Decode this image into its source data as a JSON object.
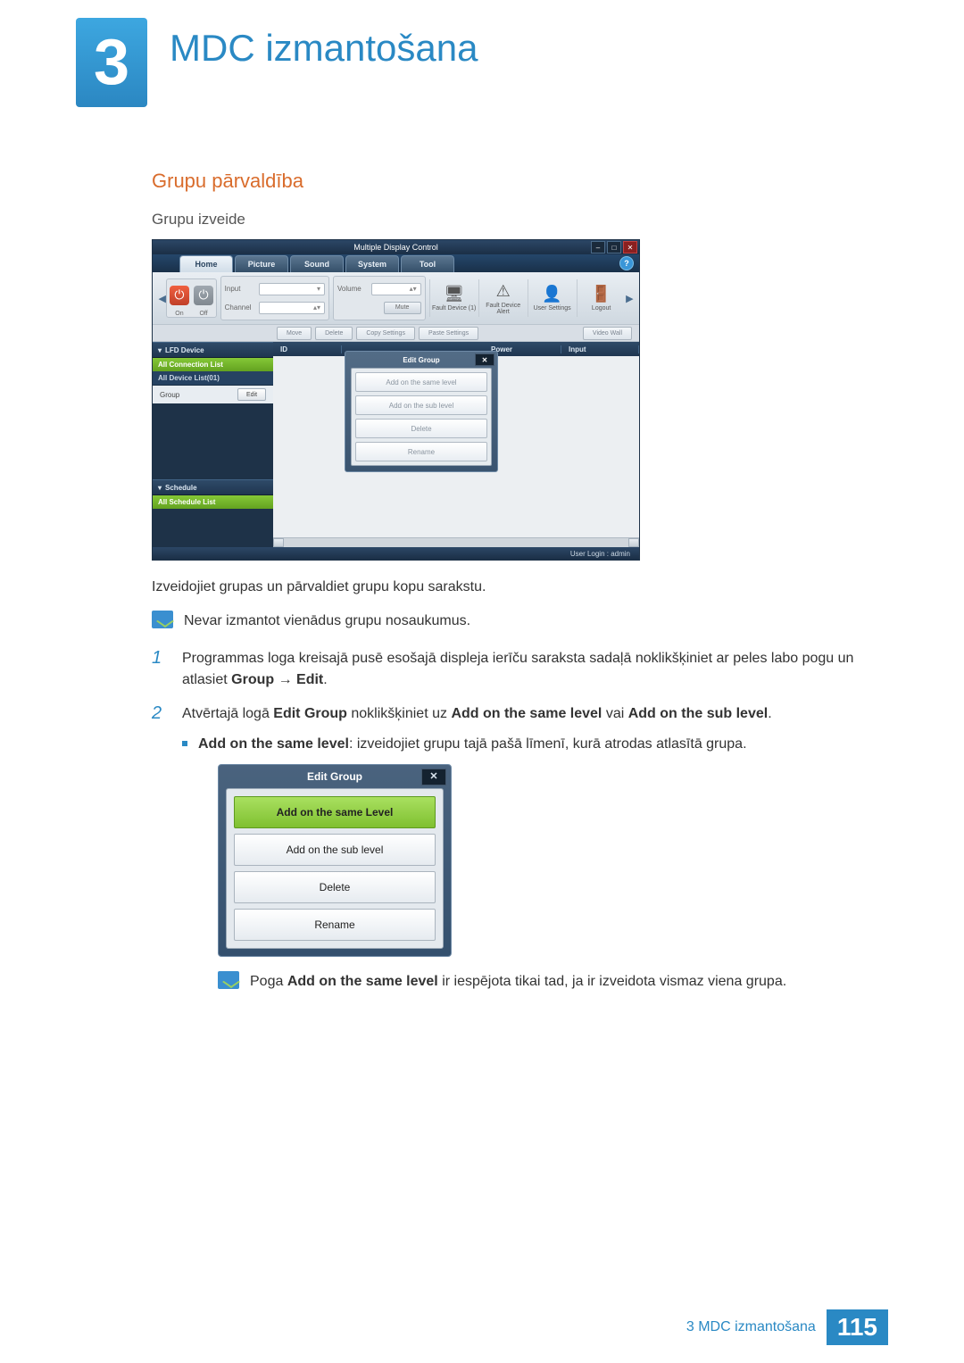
{
  "chapter": {
    "number": "3",
    "title": "MDC izmantošana"
  },
  "section": {
    "title": "Grupu pārvaldība",
    "subtitle": "Grupu izveide"
  },
  "screenshot": {
    "window_title": "Multiple Display Control",
    "tabs": [
      "Home",
      "Picture",
      "Sound",
      "System",
      "Tool"
    ],
    "power": {
      "on": "On",
      "off": "Off"
    },
    "fields": {
      "input": "Input",
      "channel": "Channel",
      "volume": "Volume",
      "mute": "Mute"
    },
    "toolbar_icons": [
      {
        "label": "Fault Device (1)",
        "glyph": "🖥"
      },
      {
        "label": "Fault Device Alert",
        "glyph": "⚠"
      },
      {
        "label": "User Settings",
        "glyph": "👤"
      },
      {
        "label": "Logout",
        "glyph": "🚪"
      }
    ],
    "action_buttons": [
      "Move",
      "Delete",
      "Copy Settings",
      "Paste Settings",
      "Video Wall"
    ],
    "sidebar": {
      "lfd_header": "LFD Device",
      "all_conn": "All Connection List",
      "all_dev": "All Device List(01)",
      "group_label": "Group",
      "edit": "Edit",
      "schedule_header": "Schedule",
      "all_schedule": "All Schedule List"
    },
    "columns": [
      "ID",
      "Power",
      "Input"
    ],
    "dialog": {
      "title": "Edit Group",
      "options": [
        "Add on the same level",
        "Add on the sub level",
        "Delete",
        "Rename"
      ]
    },
    "status": "User Login : admin"
  },
  "text": {
    "intro": "Izveidojiet grupas un pārvaldiet grupu kopu sarakstu.",
    "note1": "Nevar izmantot vienādus grupu nosaukumus.",
    "step1_a": "Programmas loga kreisajā pusē esošajā displeja ierīču saraksta sadaļā noklikšķiniet ar peles labo pogu un atlasiet ",
    "step1_b": "Group → Edit",
    "step1_c": ".",
    "step2_a": "Atvērtajā logā ",
    "step2_b": "Edit Group",
    "step2_c": " noklikšķiniet uz ",
    "step2_d": "Add on the same level",
    "step2_e": " vai ",
    "step2_f": "Add on the sub level",
    "step2_g": ".",
    "bullet_a": "Add on the same level",
    "bullet_b": ": izveidojiet grupu tajā pašā līmenī, kurā atrodas atlasītā grupa.",
    "note2_a": "Poga ",
    "note2_b": "Add on the same level",
    "note2_c": " ir iespējota tikai tad, ja ir izveidota vismaz viena grupa."
  },
  "dialog_large": {
    "title": "Edit Group",
    "options": [
      "Add on the same Level",
      "Add on the sub level",
      "Delete",
      "Rename"
    ]
  },
  "footer": {
    "label": "3 MDC izmantošana",
    "page": "115"
  }
}
